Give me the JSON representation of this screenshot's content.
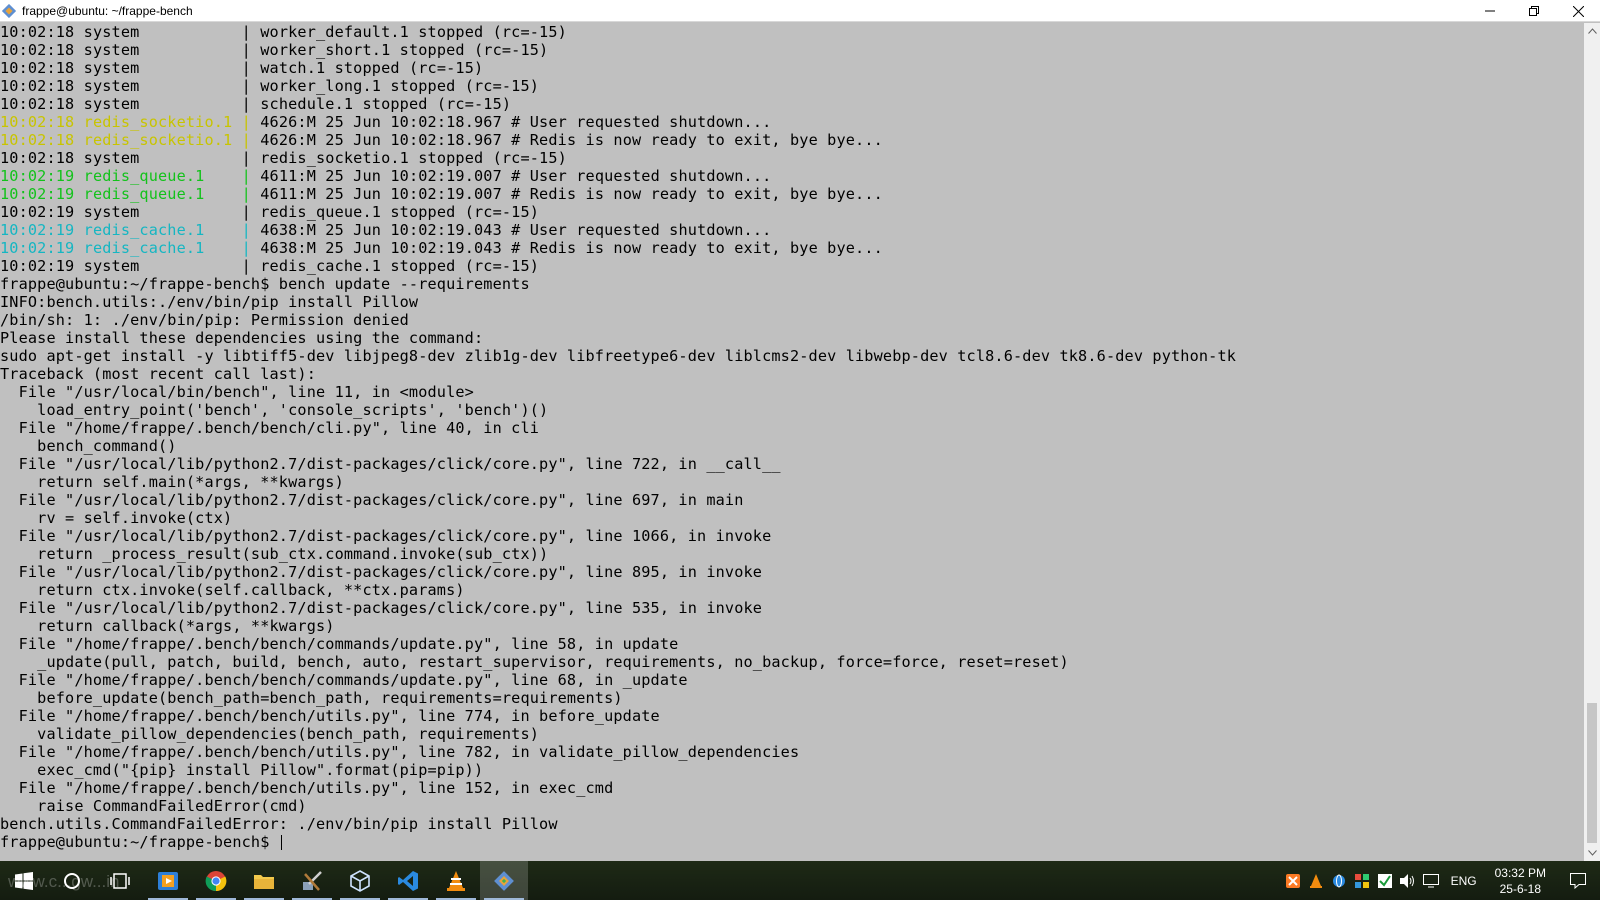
{
  "window": {
    "title": "frappe@ubuntu: ~/frappe-bench"
  },
  "colors": {
    "terminal_bg": "#c0c0c0",
    "yellow": "#c8c400",
    "green": "#13c21b",
    "cyan": "#15b6c2"
  },
  "log_lines": [
    {
      "ts": "10:02:18",
      "src": "system           ",
      "msg": "worker_default.1 stopped (rc=-15)",
      "color": ""
    },
    {
      "ts": "10:02:18",
      "src": "system           ",
      "msg": "worker_short.1 stopped (rc=-15)",
      "color": ""
    },
    {
      "ts": "10:02:18",
      "src": "system           ",
      "msg": "watch.1 stopped (rc=-15)",
      "color": ""
    },
    {
      "ts": "10:02:18",
      "src": "system           ",
      "msg": "worker_long.1 stopped (rc=-15)",
      "color": ""
    },
    {
      "ts": "10:02:18",
      "src": "system           ",
      "msg": "schedule.1 stopped (rc=-15)",
      "color": ""
    },
    {
      "ts": "10:02:18",
      "src": "redis_socketio.1 ",
      "msg": "4626:M 25 Jun 10:02:18.967 # User requested shutdown...",
      "color": "yellow"
    },
    {
      "ts": "10:02:18",
      "src": "redis_socketio.1 ",
      "msg": "4626:M 25 Jun 10:02:18.967 # Redis is now ready to exit, bye bye...",
      "color": "yellow"
    },
    {
      "ts": "10:02:18",
      "src": "system           ",
      "msg": "redis_socketio.1 stopped (rc=-15)",
      "color": ""
    },
    {
      "ts": "10:02:19",
      "src": "redis_queue.1    ",
      "msg": "4611:M 25 Jun 10:02:19.007 # User requested shutdown...",
      "color": "green"
    },
    {
      "ts": "10:02:19",
      "src": "redis_queue.1    ",
      "msg": "4611:M 25 Jun 10:02:19.007 # Redis is now ready to exit, bye bye...",
      "color": "green"
    },
    {
      "ts": "10:02:19",
      "src": "system           ",
      "msg": "redis_queue.1 stopped (rc=-15)",
      "color": ""
    },
    {
      "ts": "10:02:19",
      "src": "redis_cache.1    ",
      "msg": "4638:M 25 Jun 10:02:19.043 # User requested shutdown...",
      "color": "cyan"
    },
    {
      "ts": "10:02:19",
      "src": "redis_cache.1    ",
      "msg": "4638:M 25 Jun 10:02:19.043 # Redis is now ready to exit, bye bye...",
      "color": "cyan"
    },
    {
      "ts": "10:02:19",
      "src": "system           ",
      "msg": "redis_cache.1 stopped (rc=-15)",
      "color": ""
    }
  ],
  "output_lines": [
    "frappe@ubuntu:~/frappe-bench$ bench update --requirements",
    "INFO:bench.utils:./env/bin/pip install Pillow",
    "/bin/sh: 1: ./env/bin/pip: Permission denied",
    "Please install these dependencies using the command:",
    "sudo apt-get install -y libtiff5-dev libjpeg8-dev zlib1g-dev libfreetype6-dev liblcms2-dev libwebp-dev tcl8.6-dev tk8.6-dev python-tk",
    "Traceback (most recent call last):",
    "  File \"/usr/local/bin/bench\", line 11, in <module>",
    "    load_entry_point('bench', 'console_scripts', 'bench')()",
    "  File \"/home/frappe/.bench/bench/cli.py\", line 40, in cli",
    "    bench_command()",
    "  File \"/usr/local/lib/python2.7/dist-packages/click/core.py\", line 722, in __call__",
    "    return self.main(*args, **kwargs)",
    "  File \"/usr/local/lib/python2.7/dist-packages/click/core.py\", line 697, in main",
    "    rv = self.invoke(ctx)",
    "  File \"/usr/local/lib/python2.7/dist-packages/click/core.py\", line 1066, in invoke",
    "    return _process_result(sub_ctx.command.invoke(sub_ctx))",
    "  File \"/usr/local/lib/python2.7/dist-packages/click/core.py\", line 895, in invoke",
    "    return ctx.invoke(self.callback, **ctx.params)",
    "  File \"/usr/local/lib/python2.7/dist-packages/click/core.py\", line 535, in invoke",
    "    return callback(*args, **kwargs)",
    "  File \"/home/frappe/.bench/bench/commands/update.py\", line 58, in update",
    "    _update(pull, patch, build, bench, auto, restart_supervisor, requirements, no_backup, force=force, reset=reset)",
    "  File \"/home/frappe/.bench/bench/commands/update.py\", line 68, in _update",
    "    before_update(bench_path=bench_path, requirements=requirements)",
    "  File \"/home/frappe/.bench/bench/utils.py\", line 774, in before_update",
    "    validate_pillow_dependencies(bench_path, requirements)",
    "  File \"/home/frappe/.bench/bench/utils.py\", line 782, in validate_pillow_dependencies",
    "    exec_cmd(\"{pip} install Pillow\".format(pip=pip))",
    "  File \"/home/frappe/.bench/bench/utils.py\", line 152, in exec_cmd",
    "    raise CommandFailedError(cmd)",
    "bench.utils.CommandFailedError: ./env/bin/pip install Pillow"
  ],
  "prompt": "frappe@ubuntu:~/frappe-bench$ ",
  "taskbar": {
    "watermark": "www.c...gw...in",
    "apps": [
      {
        "name": "start-button",
        "icon": "windows-icon"
      },
      {
        "name": "search-button",
        "icon": "search-icon"
      },
      {
        "name": "task-view-button",
        "icon": "task-view-icon"
      },
      {
        "name": "media-app",
        "icon": "media-icon"
      },
      {
        "name": "chrome-app",
        "icon": "chrome-icon"
      },
      {
        "name": "file-explorer-app",
        "icon": "folder-icon"
      },
      {
        "name": "tools-app",
        "icon": "tools-icon"
      },
      {
        "name": "virtualbox-app",
        "icon": "cube-icon"
      },
      {
        "name": "vscode-app",
        "icon": "vscode-icon"
      },
      {
        "name": "vlc-app",
        "icon": "vlc-icon"
      },
      {
        "name": "git-terminal-app",
        "icon": "git-icon"
      }
    ],
    "language": "ENG",
    "time": "03:32 PM",
    "date": "25-6-18"
  }
}
